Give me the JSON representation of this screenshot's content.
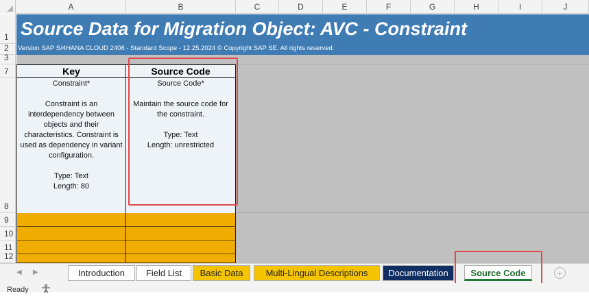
{
  "columns": [
    "A",
    "B",
    "C",
    "D",
    "E",
    "F",
    "G",
    "H",
    "I",
    "J"
  ],
  "rows": [
    "1",
    "2",
    "3",
    "7",
    "8",
    "9",
    "10",
    "11",
    "12"
  ],
  "sheet": {
    "title": "Source Data for Migration Object:  AVC - Constraint",
    "version": "Version SAP S/4HANA CLOUD 2408 - Standard Scope - 12.25.2024 © Copyright SAP SE. All rights reserved.",
    "key_header": "Key",
    "source_header": "Source Code",
    "key_desc": [
      "Constraint*",
      "",
      "Constraint is an",
      "interdependency between",
      "objects and their",
      "characteristics. Constraint is",
      "used as dependency in variant",
      "configuration.",
      "",
      "Type: Text",
      "Length: 80"
    ],
    "source_desc": [
      "Source Code*",
      "",
      "Maintain the source code for",
      "the constraint.",
      "",
      "Type: Text",
      "Length: unrestricted"
    ]
  },
  "tabs": [
    {
      "label": "Introduction",
      "style": "white"
    },
    {
      "label": "Field List",
      "style": "white"
    },
    {
      "label": "Basic Data",
      "style": "yellow"
    },
    {
      "label": "Multi-Lingual Descriptions",
      "style": "yellow"
    },
    {
      "label": "Documentation",
      "style": "navy"
    },
    {
      "label": "Source Code",
      "style": "active"
    }
  ],
  "tab_icons": {
    "prev": "triangle-left-icon",
    "next": "triangle-right-icon",
    "add": "plus-circle-icon"
  },
  "status": {
    "ready": "Ready",
    "accessibility_icon": "accessibility-icon"
  },
  "colors": {
    "title_band": "#3f7cb4",
    "header_fill": "#eef3f8",
    "orange_fill": "#f0ad00",
    "highlight": "#e0484b",
    "navy_tab": "#0f2f63",
    "yellow_tab": "#f5c400",
    "active_tab_text": "#1e6b2d"
  }
}
